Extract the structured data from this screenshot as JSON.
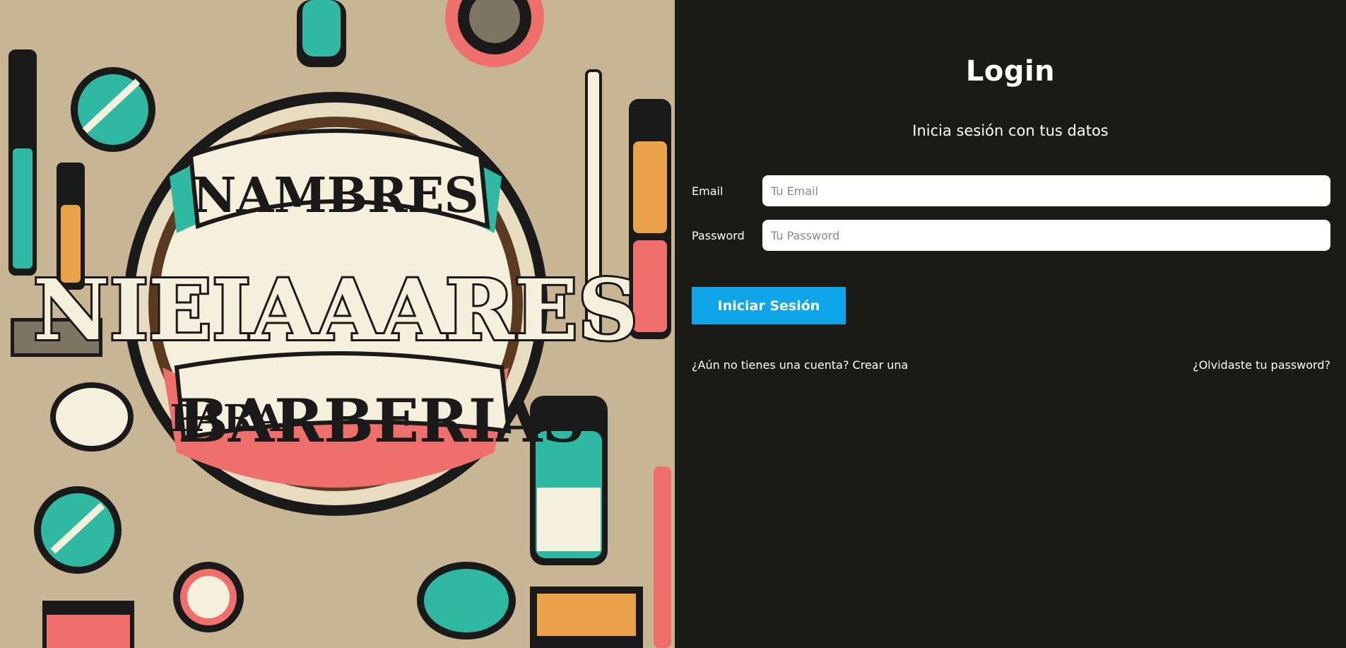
{
  "login": {
    "title": "Login",
    "subtitle": "Inicia sesión con tus datos",
    "email_label": "Email",
    "email_placeholder": "Tu Email",
    "email_value": "",
    "password_label": "Password",
    "password_placeholder": "Tu Password",
    "password_value": "",
    "submit_label": "Iniciar Sesión",
    "create_account_link": "¿Aún no tienes una cuenta? Crear una",
    "forgot_password_link": "¿Olvidaste tu password?"
  },
  "artwork": {
    "banner_top": "NAMBRES",
    "banner_middle": "NIEIAAARES",
    "banner_bottom_small": "PARA",
    "banner_bottom_large": "BARBERIAS"
  },
  "colors": {
    "background": "#1a1b16",
    "button": "#0ea5e9",
    "input_bg": "#ffffff",
    "art_teal": "#2fb9a3",
    "art_coral": "#ef6f6c",
    "art_cream": "#f5f0dc",
    "art_tan": "#c7b593"
  }
}
